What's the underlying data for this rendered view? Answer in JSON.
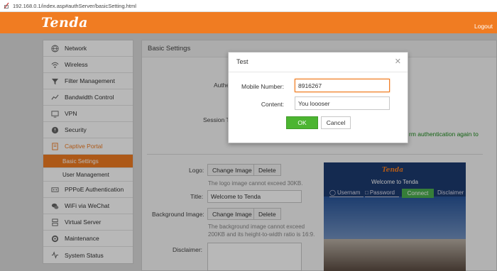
{
  "address_bar": {
    "url": "192.168.0.1/index.asp#authServer/basicSetting.html"
  },
  "header": {
    "logo": "Tenda",
    "logout_label": "Logout"
  },
  "sidebar": {
    "items": [
      {
        "label": "Network",
        "icon": "globe-icon"
      },
      {
        "label": "Wireless",
        "icon": "wifi-icon"
      },
      {
        "label": "Filter Management",
        "icon": "filter-icon"
      },
      {
        "label": "Bandwidth Control",
        "icon": "bandwidth-icon"
      },
      {
        "label": "VPN",
        "icon": "vpn-icon"
      },
      {
        "label": "Security",
        "icon": "shield-icon"
      },
      {
        "label": "Captive Portal",
        "icon": "portal-icon"
      },
      {
        "label": "PPPoE Authentication",
        "icon": "pppoe-icon"
      },
      {
        "label": "WiFi via WeChat",
        "icon": "wechat-icon"
      },
      {
        "label": "Virtual Server",
        "icon": "server-icon"
      },
      {
        "label": "Maintenance",
        "icon": "wrench-icon"
      },
      {
        "label": "System Status",
        "icon": "pulse-icon"
      }
    ],
    "subitems": [
      {
        "label": "Basic Settings"
      },
      {
        "label": "User Management"
      }
    ]
  },
  "panel": {
    "title": "Basic Settings",
    "auth_label_partial": "Authe",
    "session_label_partial": "Session Ti",
    "green_text": "rm authentication again to",
    "logo_label": "Logo:",
    "change_image_label": "Change Image",
    "delete_label": "Delete",
    "logo_hint": "The logo image cannot exceed 30KB.",
    "title_label": "Title:",
    "title_value": "Welcome to Tenda",
    "bg_image_label": "Background Image:",
    "bg_hint": "The background image cannot exceed 200KB and its height-to-width ratio is 16:9.",
    "disclaimer_label": "Disclaimer:"
  },
  "preview": {
    "logo": "Tenda",
    "welcome": "Welcome to Tenda",
    "username_placeholder": "Usernam",
    "password_placeholder": "Password",
    "connect_label": "Connect",
    "disclaimer_label": "Disclaimer"
  },
  "dialog": {
    "title": "Test",
    "mobile_label": "Mobile Number:",
    "mobile_value": "8916267",
    "content_label": "Content:",
    "content_value": "You loooser",
    "ok_label": "OK",
    "cancel_label": "Cancel"
  },
  "colors": {
    "accent": "#f07c22",
    "ok_green": "#4cb531"
  }
}
